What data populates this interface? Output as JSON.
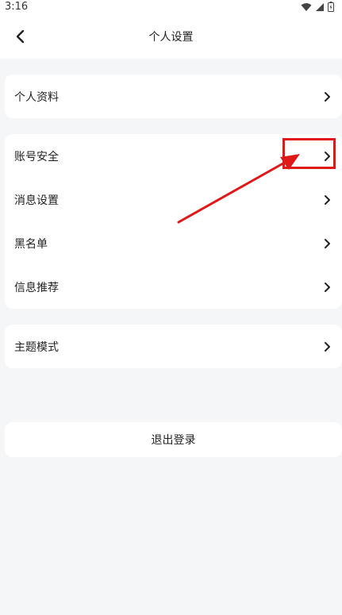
{
  "status": {
    "time": "3:16"
  },
  "header": {
    "title": "个人设置"
  },
  "sections": [
    {
      "items": [
        "个人资料"
      ]
    },
    {
      "items": [
        "账号安全",
        "消息设置",
        "黑名单",
        "信息推荐"
      ]
    },
    {
      "items": [
        "主题模式"
      ]
    }
  ],
  "logout": {
    "label": "退出登录"
  },
  "colors": {
    "highlight": "#e01818",
    "background": "#f5f6f8"
  },
  "icons": [
    "back-icon",
    "chevron-right-icon",
    "wifi-icon",
    "signal-icon",
    "battery-icon"
  ]
}
